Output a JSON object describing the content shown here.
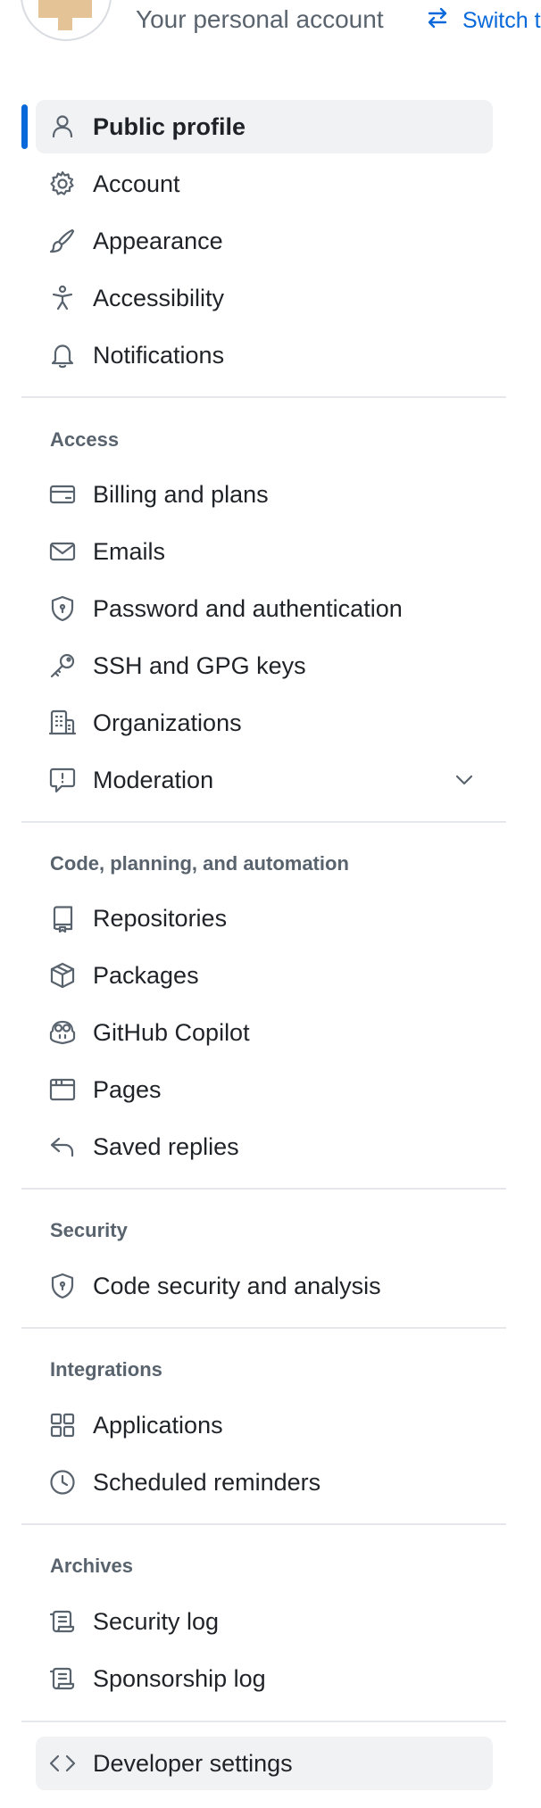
{
  "header": {
    "title": "Your personal account",
    "switch_label": "Switch t"
  },
  "colors": {
    "accent": "#0969da",
    "text": "#1f2328",
    "muted": "#59636e",
    "active_bg": "#f1f2f4",
    "divider": "#e5e7ea"
  },
  "nav": {
    "main": [
      {
        "label": "Public profile",
        "icon": "person-icon",
        "active": true
      },
      {
        "label": "Account",
        "icon": "gear-icon"
      },
      {
        "label": "Appearance",
        "icon": "paintbrush-icon"
      },
      {
        "label": "Accessibility",
        "icon": "accessibility-icon"
      },
      {
        "label": "Notifications",
        "icon": "bell-icon"
      }
    ],
    "access": {
      "title": "Access",
      "items": [
        {
          "label": "Billing and plans",
          "icon": "credit-card-icon"
        },
        {
          "label": "Emails",
          "icon": "mail-icon"
        },
        {
          "label": "Password and authentication",
          "icon": "shield-lock-icon"
        },
        {
          "label": "SSH and GPG keys",
          "icon": "key-icon"
        },
        {
          "label": "Organizations",
          "icon": "organization-icon"
        },
        {
          "label": "Moderation",
          "icon": "report-icon",
          "expandable": true
        }
      ]
    },
    "code": {
      "title": "Code, planning, and automation",
      "items": [
        {
          "label": "Repositories",
          "icon": "repo-icon"
        },
        {
          "label": "Packages",
          "icon": "package-icon"
        },
        {
          "label": "GitHub Copilot",
          "icon": "copilot-icon"
        },
        {
          "label": "Pages",
          "icon": "browser-icon"
        },
        {
          "label": "Saved replies",
          "icon": "reply-icon"
        }
      ]
    },
    "security": {
      "title": "Security",
      "items": [
        {
          "label": "Code security and analysis",
          "icon": "shield-lock-icon"
        }
      ]
    },
    "integrations": {
      "title": "Integrations",
      "items": [
        {
          "label": "Applications",
          "icon": "apps-icon"
        },
        {
          "label": "Scheduled reminders",
          "icon": "clock-icon"
        }
      ]
    },
    "archives": {
      "title": "Archives",
      "items": [
        {
          "label": "Security log",
          "icon": "log-icon"
        },
        {
          "label": "Sponsorship log",
          "icon": "log-icon"
        }
      ]
    },
    "developer": {
      "label": "Developer settings",
      "icon": "code-icon"
    }
  }
}
